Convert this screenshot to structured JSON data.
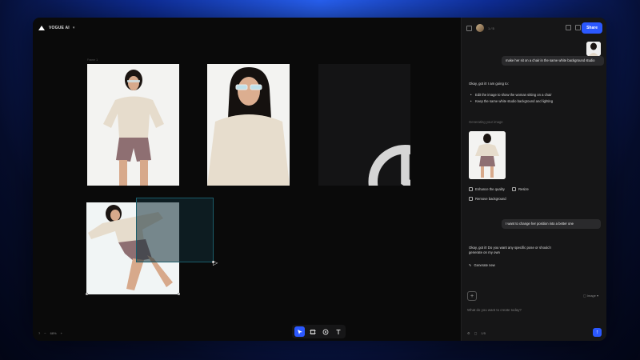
{
  "app": {
    "project_name": "VOGUE AI",
    "frame_label": "Frame 1",
    "zoom": "68%",
    "help": "?"
  },
  "toolbar": {
    "tools": [
      "select-tool",
      "frame-tool",
      "image-tool",
      "text-tool"
    ]
  },
  "panel": {
    "share_label": "Share",
    "header_text": "1 / 5",
    "user_message_1": "make her sit on a chair in the same white background studio",
    "ai_intro": "Okay, got it! I am going to:",
    "ai_bullets": [
      "Edit the image to show the woman sitting on a chair",
      "Keep the same white studio background and lighting"
    ],
    "working_text": "Generating your image",
    "actions": [
      "Enhance the quality",
      "Resize",
      "Remove background"
    ],
    "user_message_2": "I want to change her position into a better one",
    "ai_reply_2": "Okay, got it! Do you want any specific pose or should I generate on my own",
    "generate_label": "Generate new",
    "input_placeholder": "What do you want to create today?",
    "image_select": "Image",
    "footer_count": "1/5",
    "send_symbol": "↑",
    "plus_symbol": "+"
  },
  "colors": {
    "accent": "#2b58ff",
    "canvas": "#0a0a0a",
    "panel": "#161617",
    "selection": "#1b5d6a"
  }
}
